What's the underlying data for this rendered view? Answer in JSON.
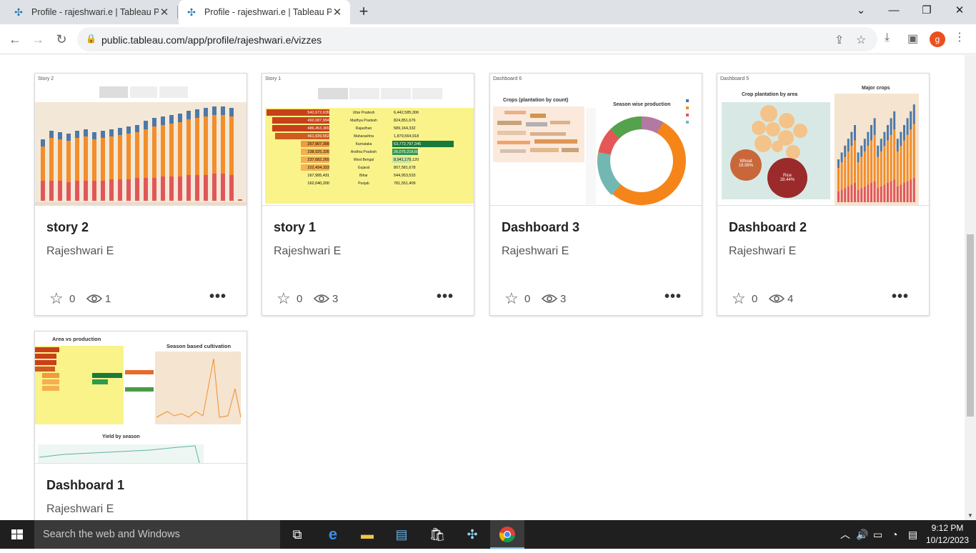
{
  "browser": {
    "tabs": [
      {
        "title": "Profile - rajeshwari.e | Tableau Pu",
        "active": false
      },
      {
        "title": "Profile - rajeshwari.e | Tableau Pu",
        "active": true
      }
    ],
    "url": "public.tableau.com/app/profile/rajeshwari.e/vizzes",
    "avatar_letter": "g"
  },
  "cards": [
    {
      "title": "story 2",
      "author": "Rajeshwari E",
      "favorites": "0",
      "views": "1",
      "thumb_label": "Story 2"
    },
    {
      "title": "story 1",
      "author": "Rajeshwari E",
      "favorites": "0",
      "views": "3",
      "thumb_label": "Story 1"
    },
    {
      "title": "Dashboard 3",
      "author": "Rajeshwari E",
      "favorites": "0",
      "views": "3",
      "thumb_label": "Dashboard 6"
    },
    {
      "title": "Dashboard 2",
      "author": "Rajeshwari E",
      "favorites": "0",
      "views": "4",
      "thumb_label": "Dashboard 5"
    },
    {
      "title": "Dashboard 1",
      "author": "Rajeshwari E",
      "thumb_label": ""
    }
  ],
  "thumbs": {
    "story1_areas": [
      "542,672,635",
      "492,087,994",
      "486,453,365",
      "461,939,552",
      "257,907,399",
      "238,925,335",
      "237,682,265",
      "222,434,333",
      "167,995,431",
      "162,040,200"
    ],
    "story1_states": [
      "Uttar Pradesh",
      "Madhya Pradesh",
      "Rajasthan",
      "Maharashtra",
      "Karnataka",
      "Andhra Pradesh",
      "West Bengal",
      "Gujarat",
      "Bihar",
      "Punjab"
    ],
    "story1_prod": [
      "6,442,585,306",
      "824,851,676",
      "589,164,332",
      "1,879,564,918",
      "53,772,797,345",
      "26,075,218,605",
      "8,941,179,120",
      "807,581,678",
      "544,953,533",
      "781,551,409"
    ],
    "d3_title_left": "Crops (plantation by count)",
    "d3_title_right": "Season wise production",
    "d2_title_left": "Crop plantation by area",
    "d2_title_right": "Major crops",
    "d2_wheat": "Wheat",
    "d2_wheat_pct": "18.98%",
    "d2_rice": "Rice",
    "d2_rice_pct": "28.44%",
    "d1_title_left": "Area vs production",
    "d1_title_right": "Season based cultivation",
    "d1_title_bottom": "Yield by season"
  },
  "taskbar": {
    "search_placeholder": "Search the web and Windows",
    "time": "9:12 PM",
    "date": "10/12/2023"
  }
}
